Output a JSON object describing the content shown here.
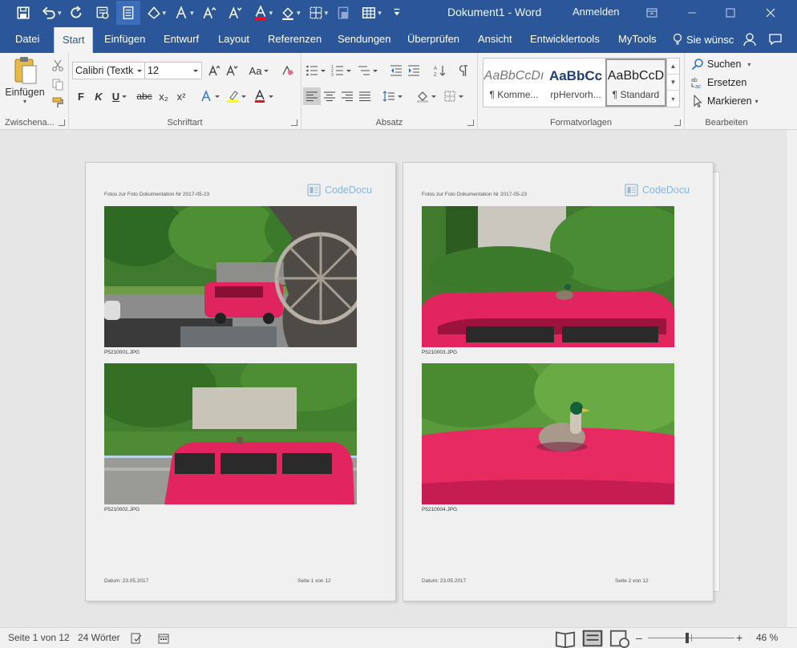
{
  "window": {
    "title": "Dokument1  -  Word",
    "signin": "Anmelden"
  },
  "tabs": [
    {
      "label": "Datei"
    },
    {
      "label": "Start"
    },
    {
      "label": "Einfügen"
    },
    {
      "label": "Entwurf"
    },
    {
      "label": "Layout"
    },
    {
      "label": "Referenzen"
    },
    {
      "label": "Sendungen"
    },
    {
      "label": "Überprüfen"
    },
    {
      "label": "Ansicht"
    },
    {
      "label": "Entwicklertools"
    },
    {
      "label": "MyTools"
    }
  ],
  "tell_me": "Sie wünsc",
  "ribbon": {
    "clipboard": {
      "paste_label": "Einfügen",
      "group_label": "Zwischena..."
    },
    "font": {
      "name": "Calibri (Textk",
      "size": "12",
      "case_label": "Aa",
      "bold": "F",
      "italic": "K",
      "underline": "U",
      "strike": "abc",
      "subscript": "x₂",
      "superscript": "x²",
      "group_label": "Schriftart"
    },
    "paragraph": {
      "group_label": "Absatz"
    },
    "styles": {
      "items": [
        {
          "sample": "AaBbCcDı",
          "name": "¶ Komme..."
        },
        {
          "sample": "AaBbCc",
          "name": "rpHervorh..."
        },
        {
          "sample": "AaBbCcD",
          "name": "¶ Standard"
        }
      ],
      "group_label": "Formatvorlagen"
    },
    "editing": {
      "find": "Suchen",
      "replace": "Ersetzen",
      "select": "Markieren",
      "group_label": "Bearbeiten"
    }
  },
  "pages": [
    {
      "header": "Fotos zur Foto Dokumentation Nr 2017-05-23",
      "logo": "CodeDocu",
      "photos": [
        {
          "caption": "P5210001.JPG"
        },
        {
          "caption": "P5210002.JPG"
        }
      ],
      "footer_left": "Datum: 23.05.2017",
      "footer_right": "Seite 1 von 12"
    },
    {
      "header": "Fotos zur Foto Dokumentation Nr 2017-05-23",
      "logo": "CodeDocu",
      "photos": [
        {
          "caption": "P5210003.JPG"
        },
        {
          "caption": "P5210004.JPG"
        }
      ],
      "footer_left": "Datum: 23.05.2017",
      "footer_right": "Seite 2 von 12"
    }
  ],
  "status": {
    "page": "Seite 1 von 12",
    "words": "24 Wörter",
    "zoom": "46 %"
  },
  "colors": {
    "title_bar": "#2b579a",
    "ribbon": "#f3f3f3",
    "document_background": "#e6e6e6",
    "van_pink": "#e8326e"
  }
}
